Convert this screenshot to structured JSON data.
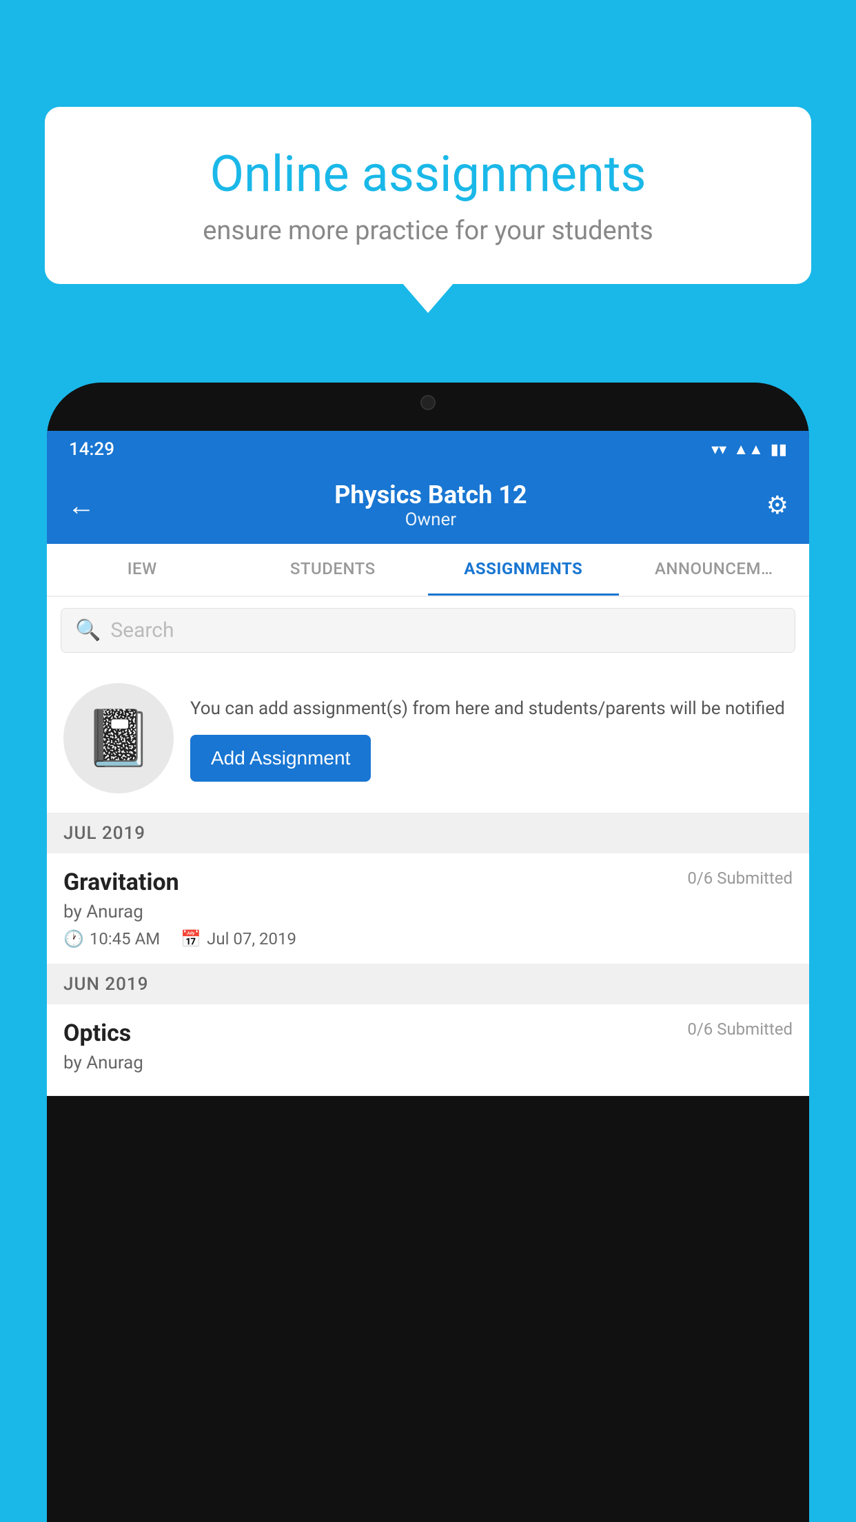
{
  "background": {
    "color": "#1ab8e8"
  },
  "speech_bubble": {
    "title": "Online assignments",
    "subtitle": "ensure more practice for your students"
  },
  "status_bar": {
    "time": "14:29",
    "wifi_icon": "▼",
    "signal_icon": "▲",
    "battery_icon": "▮"
  },
  "header": {
    "title": "Physics Batch 12",
    "subtitle": "Owner",
    "back_icon": "←",
    "settings_icon": "⚙"
  },
  "tabs": [
    {
      "label": "IEW",
      "active": false
    },
    {
      "label": "STUDENTS",
      "active": false
    },
    {
      "label": "ASSIGNMENTS",
      "active": true
    },
    {
      "label": "ANNOUNCEMENTS",
      "active": false
    }
  ],
  "search": {
    "placeholder": "Search"
  },
  "empty_state": {
    "description": "You can add assignment(s) from here and students/parents will be notified",
    "button_label": "Add Assignment"
  },
  "assignment_groups": [
    {
      "month": "JUL 2019",
      "assignments": [
        {
          "name": "Gravitation",
          "submitted": "0/6 Submitted",
          "by": "by Anurag",
          "time": "10:45 AM",
          "date": "Jul 07, 2019"
        }
      ]
    },
    {
      "month": "JUN 2019",
      "assignments": [
        {
          "name": "Optics",
          "submitted": "0/6 Submitted",
          "by": "by Anurag",
          "time": "",
          "date": ""
        }
      ]
    }
  ]
}
